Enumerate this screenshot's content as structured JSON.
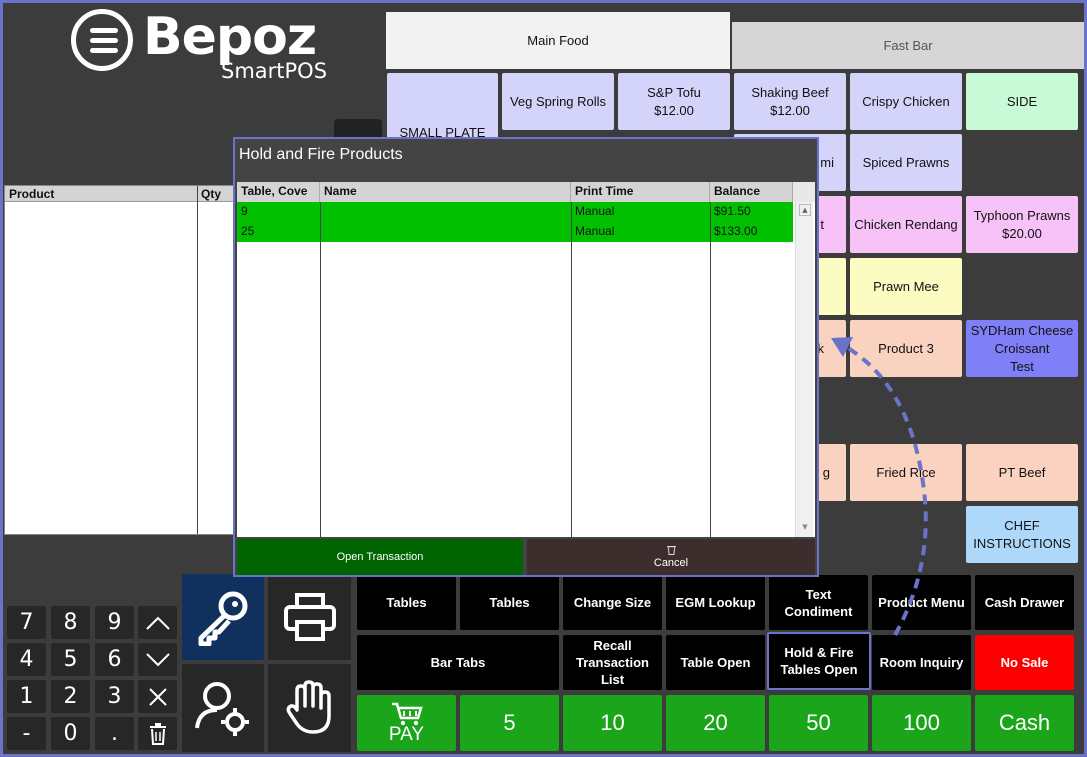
{
  "logo": {
    "name": "Bepoz",
    "sub": "SmartPOS"
  },
  "tabs": [
    {
      "label": "Main Food",
      "active": true
    },
    {
      "label": "Fast Bar",
      "active": false
    }
  ],
  "products": {
    "small_plate": "SMALL PLATE",
    "veg_spring_rolls": "Veg Spring Rolls",
    "sp_tofu": {
      "name": "S&P Tofu",
      "price": "$12.00"
    },
    "shaking_beef": {
      "name": "Shaking Beef",
      "price": "$12.00"
    },
    "crispy_chicken": "Crispy Chicken",
    "side": "SIDE",
    "hidden_mi": "mi",
    "spiced_prawns": "Spiced Prawns",
    "hidden_t": "t",
    "chicken_rendang": "Chicken Rendang",
    "typhoon_prawns": {
      "name": "Typhoon Prawns",
      "price": "$20.00"
    },
    "prawn_mee": "Prawn Mee",
    "hidden_k": "k",
    "product_3": "Product 3",
    "sydham": {
      "line1": "SYDHam Cheese",
      "line2": "Croissant",
      "line3": "Test"
    },
    "hidden_g": "g",
    "fried_rice": "Fried Rice",
    "pt_beef": "PT Beef",
    "chef": {
      "line1": "CHEF",
      "line2": "INSTRUCTIONS"
    }
  },
  "order": {
    "col_product": "Product",
    "col_qty": "Qty"
  },
  "keypad": [
    "7",
    "8",
    "9",
    "4",
    "5",
    "6",
    "1",
    "2",
    "3",
    "-",
    "0",
    "."
  ],
  "functions": {
    "tables_1": "Tables",
    "tables_2": "Tables",
    "change_size": "Change Size",
    "egm_lookup": "EGM Lookup",
    "text_condiment": {
      "line1": "Text",
      "line2": "Condiment"
    },
    "product_menu": "Product Menu",
    "cash_drawer": "Cash Drawer",
    "bar_tabs": "Bar Tabs",
    "recall": {
      "line1": "Recall",
      "line2": "Transaction",
      "line3": "List"
    },
    "table_open": "Table Open",
    "hold_fire": {
      "line1": "Hold & Fire",
      "line2": "Tables Open"
    },
    "room_inquiry": "Room Inquiry",
    "no_sale": "No Sale"
  },
  "payment": {
    "pay": "PAY",
    "d5": "5",
    "d10": "10",
    "d20": "20",
    "d50": "50",
    "d100": "100",
    "cash": "Cash"
  },
  "dialog": {
    "title": "Hold and Fire Products",
    "columns": [
      "Table, Cove",
      "Name",
      "Print Time",
      "Balance"
    ],
    "rows": [
      {
        "table": "9",
        "name": "",
        "print_time": "Manual",
        "balance": "$91.50"
      },
      {
        "table": "25",
        "name": "",
        "print_time": "Manual",
        "balance": "$133.00"
      }
    ],
    "open_transaction": "Open Transaction",
    "cancel": "Cancel"
  },
  "colors": {
    "accent": "#6b72c9",
    "lavender": "#d4d4fa",
    "pink": "#f7c2f7",
    "yellow": "#fbfbc2",
    "peach": "#fad2c0",
    "mint": "#c8fad8",
    "blue": "#7f7ff7",
    "light_blue": "#aed8fa",
    "green": "#1aa51a",
    "red": "#fb0000"
  }
}
